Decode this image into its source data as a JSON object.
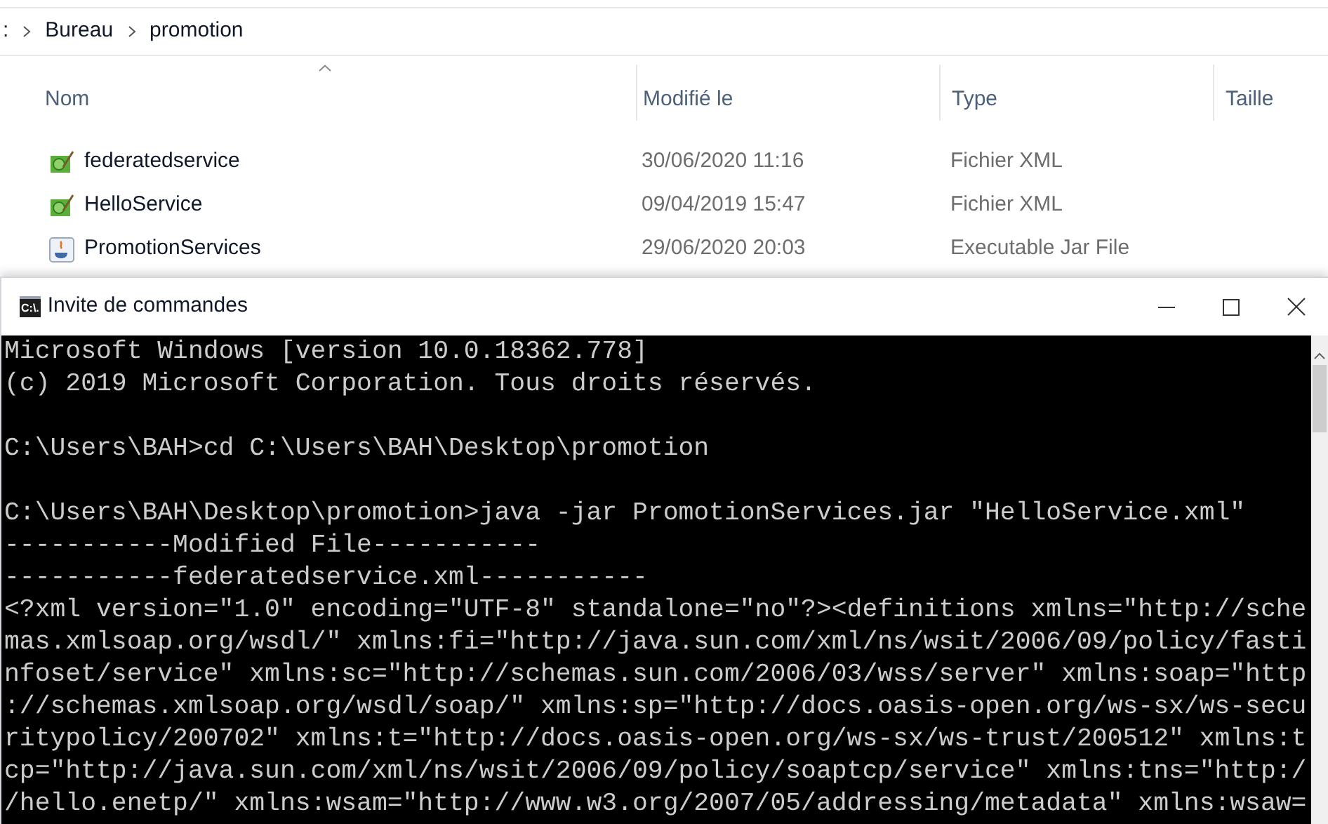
{
  "explorer": {
    "breadcrumb": [
      ":",
      "Bureau",
      "promotion"
    ],
    "columns": [
      {
        "label": "Nom",
        "sorted": true
      },
      {
        "label": "Modifié le",
        "sorted": false
      },
      {
        "label": "Type",
        "sorted": false
      },
      {
        "label": "Taille",
        "sorted": false
      }
    ],
    "files": [
      {
        "kind": "xml",
        "name": "federatedservice",
        "modified": "30/06/2020 11:16",
        "type": "Fichier XML"
      },
      {
        "kind": "xml",
        "name": "HelloService",
        "modified": "09/04/2019 15:47",
        "type": "Fichier XML"
      },
      {
        "kind": "jar",
        "name": "PromotionServices",
        "modified": "29/06/2020 20:03",
        "type": "Executable Jar File"
      }
    ]
  },
  "console": {
    "title": "Invite de commandes",
    "icon_text": "C:\\.",
    "blocks": [
      [
        "Microsoft Windows [version 10.0.18362.778]",
        "(c) 2019 Microsoft Corporation. Tous droits réservés."
      ],
      [
        "C:\\Users\\BAH>cd C:\\Users\\BAH\\Desktop\\promotion"
      ],
      [
        "C:\\Users\\BAH\\Desktop\\promotion>java -jar PromotionServices.jar \"HelloService.xml\"",
        "-----------Modified File-----------",
        "-----------federatedservice.xml-----------",
        "<?xml version=\"1.0\" encoding=\"UTF-8\" standalone=\"no\"?><definitions xmlns=\"http://sche",
        "mas.xmlsoap.org/wsdl/\" xmlns:fi=\"http://java.sun.com/xml/ns/wsit/2006/09/policy/fasti",
        "nfoset/service\" xmlns:sc=\"http://schemas.sun.com/2006/03/wss/server\" xmlns:soap=\"http",
        "://schemas.xmlsoap.org/wsdl/soap/\" xmlns:sp=\"http://docs.oasis-open.org/ws-sx/ws-secu",
        "ritypolicy/200702\" xmlns:t=\"http://docs.oasis-open.org/ws-sx/ws-trust/200512\" xmlns:t",
        "cp=\"http://java.sun.com/xml/ns/wsit/2006/09/policy/soaptcp/service\" xmlns:tns=\"http:/",
        "/hello.enetp/\" xmlns:wsam=\"http://www.w3.org/2007/05/addressing/metadata\" xmlns:wsaw="
      ]
    ]
  }
}
